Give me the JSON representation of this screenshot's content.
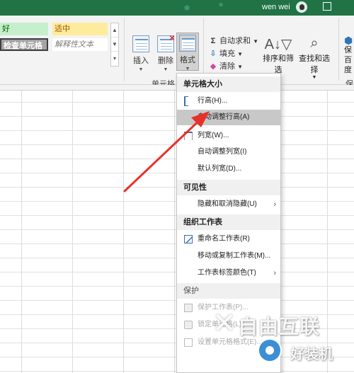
{
  "titlebar": {
    "username": "wen wei"
  },
  "styles": {
    "good": "好",
    "neutral": "适中",
    "check_cell": "检查单元格",
    "explanatory": "解释性文本"
  },
  "cells_group": {
    "insert_label": "插入",
    "delete_label": "删除",
    "format_label": "格式",
    "group_label": "单元格"
  },
  "editing_group": {
    "autosum_label": "自动求和",
    "fill_label": "填充",
    "clear_label": "清除",
    "sort_filter_label": "排序和筛选",
    "find_select_label": "查找和选择",
    "partial_label": "保",
    "partial_label2": "百度",
    "partial_group_label": "保"
  },
  "format_menu": {
    "section_cell_size": "单元格大小",
    "row_height": "行高(H)...",
    "autofit_row_height": "自动调整行高(A)",
    "column_width": "列宽(W)...",
    "autofit_column_width": "自动调整列宽(I)",
    "default_width": "默认列宽(D)...",
    "section_visibility": "可见性",
    "hide_unhide": "隐藏和取消隐藏(U)",
    "section_organize": "组织工作表",
    "rename_sheet": "重命名工作表(R)",
    "move_copy_sheet": "移动或复制工作表(M)...",
    "tab_color": "工作表标签颜色(T)",
    "section_protection": "保护",
    "protect_sheet": "保护工作表(P)...",
    "lock_cell": "锁定单元格(L)",
    "format_cells": "设置单元格格式(E)..."
  },
  "watermark": {
    "brand1": "自由互联",
    "brand2": "好装机"
  },
  "colors": {
    "titlebar": "#217346",
    "arrow": "#e8312a",
    "menu_highlight": "#c8c8c8"
  }
}
